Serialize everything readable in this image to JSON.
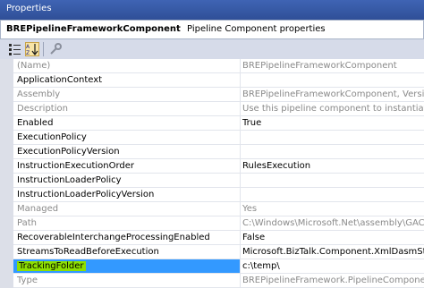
{
  "panel": {
    "title": "Properties"
  },
  "object": {
    "name": "BREPipelineFrameworkComponent",
    "type": "Pipeline Component properties"
  },
  "toolbar": {
    "categorized_icon": "categorized-icon",
    "alphabetical_icon": "alphabetical-icon",
    "property_pages_icon": "property-pages-icon"
  },
  "rows": [
    {
      "name": "(Name)",
      "value": "BREPipelineFrameworkComponent",
      "readonly": true
    },
    {
      "name": "ApplicationContext",
      "value": "",
      "readonly": false
    },
    {
      "name": "Assembly",
      "value": "BREPipelineFrameworkComponent, Version=",
      "readonly": true
    },
    {
      "name": "Description",
      "value": "Use this pipeline component to instantiate and",
      "readonly": true
    },
    {
      "name": "Enabled",
      "value": "True",
      "readonly": false
    },
    {
      "name": "ExecutionPolicy",
      "value": "",
      "readonly": false
    },
    {
      "name": "ExecutionPolicyVersion",
      "value": "",
      "readonly": false
    },
    {
      "name": "InstructionExecutionOrder",
      "value": "RulesExecution",
      "readonly": false
    },
    {
      "name": "InstructionLoaderPolicy",
      "value": "",
      "readonly": false
    },
    {
      "name": "InstructionLoaderPolicyVersion",
      "value": "",
      "readonly": false
    },
    {
      "name": "Managed",
      "value": "Yes",
      "readonly": true
    },
    {
      "name": "Path",
      "value": "C:\\Windows\\Microsoft.Net\\assembly\\GAC_M",
      "readonly": true
    },
    {
      "name": "RecoverableInterchangeProcessingEnabled",
      "value": "False",
      "readonly": false
    },
    {
      "name": "StreamsToReadBeforeExecution",
      "value": "Microsoft.BizTalk.Component.XmlDasmStrea",
      "readonly": false
    },
    {
      "name": "TrackingFolder",
      "value": "c:\\temp\\",
      "readonly": false,
      "selected": true
    },
    {
      "name": "Type",
      "value": "BREPipelineFramework.PipelineComponents.",
      "readonly": true
    }
  ]
}
